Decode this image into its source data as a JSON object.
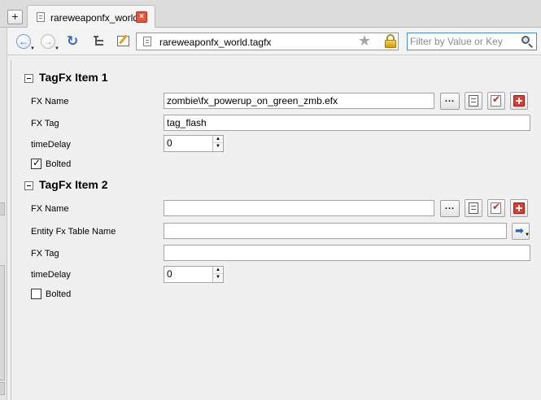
{
  "tab": {
    "label": "rareweaponfx_world",
    "close_glyph": "×",
    "new_tab_glyph": "+"
  },
  "toolbar": {
    "address": "rareweaponfx_world.tagfx",
    "filter_placeholder": "Filter by Value or Key",
    "filter_value": "",
    "icons": [
      "back-icon",
      "forward-icon",
      "refresh-icon",
      "tree-view-icon",
      "edit-icon",
      "star-icon",
      "lock-icon",
      "search-icon"
    ]
  },
  "sections": [
    {
      "title": "TagFx Item 1",
      "fx_name_label": "FX Name",
      "fx_name_value": "zombie\\fx_powerup_on_green_zmb.efx",
      "fx_tag_label": "FX Tag",
      "fx_tag_value": "tag_flash",
      "time_delay_label": "timeDelay",
      "time_delay_value": "0",
      "bolted_label": "Bolted",
      "bolted_checked": true,
      "browse_label": "..."
    },
    {
      "title": "TagFx Item 2",
      "fx_name_label": "FX Name",
      "fx_name_value": "",
      "entity_table_label": "Entity Fx Table Name",
      "entity_table_value": "",
      "fx_tag_label": "FX Tag",
      "fx_tag_value": "",
      "time_delay_label": "timeDelay",
      "time_delay_value": "0",
      "bolted_label": "Bolted",
      "bolted_checked": false,
      "browse_label": "..."
    }
  ],
  "colors": {
    "tab_close": "#e8553d",
    "accent_blue": "#2c6cc8",
    "filter_border": "#4a8fd3",
    "add_button": "#e33b2f"
  }
}
